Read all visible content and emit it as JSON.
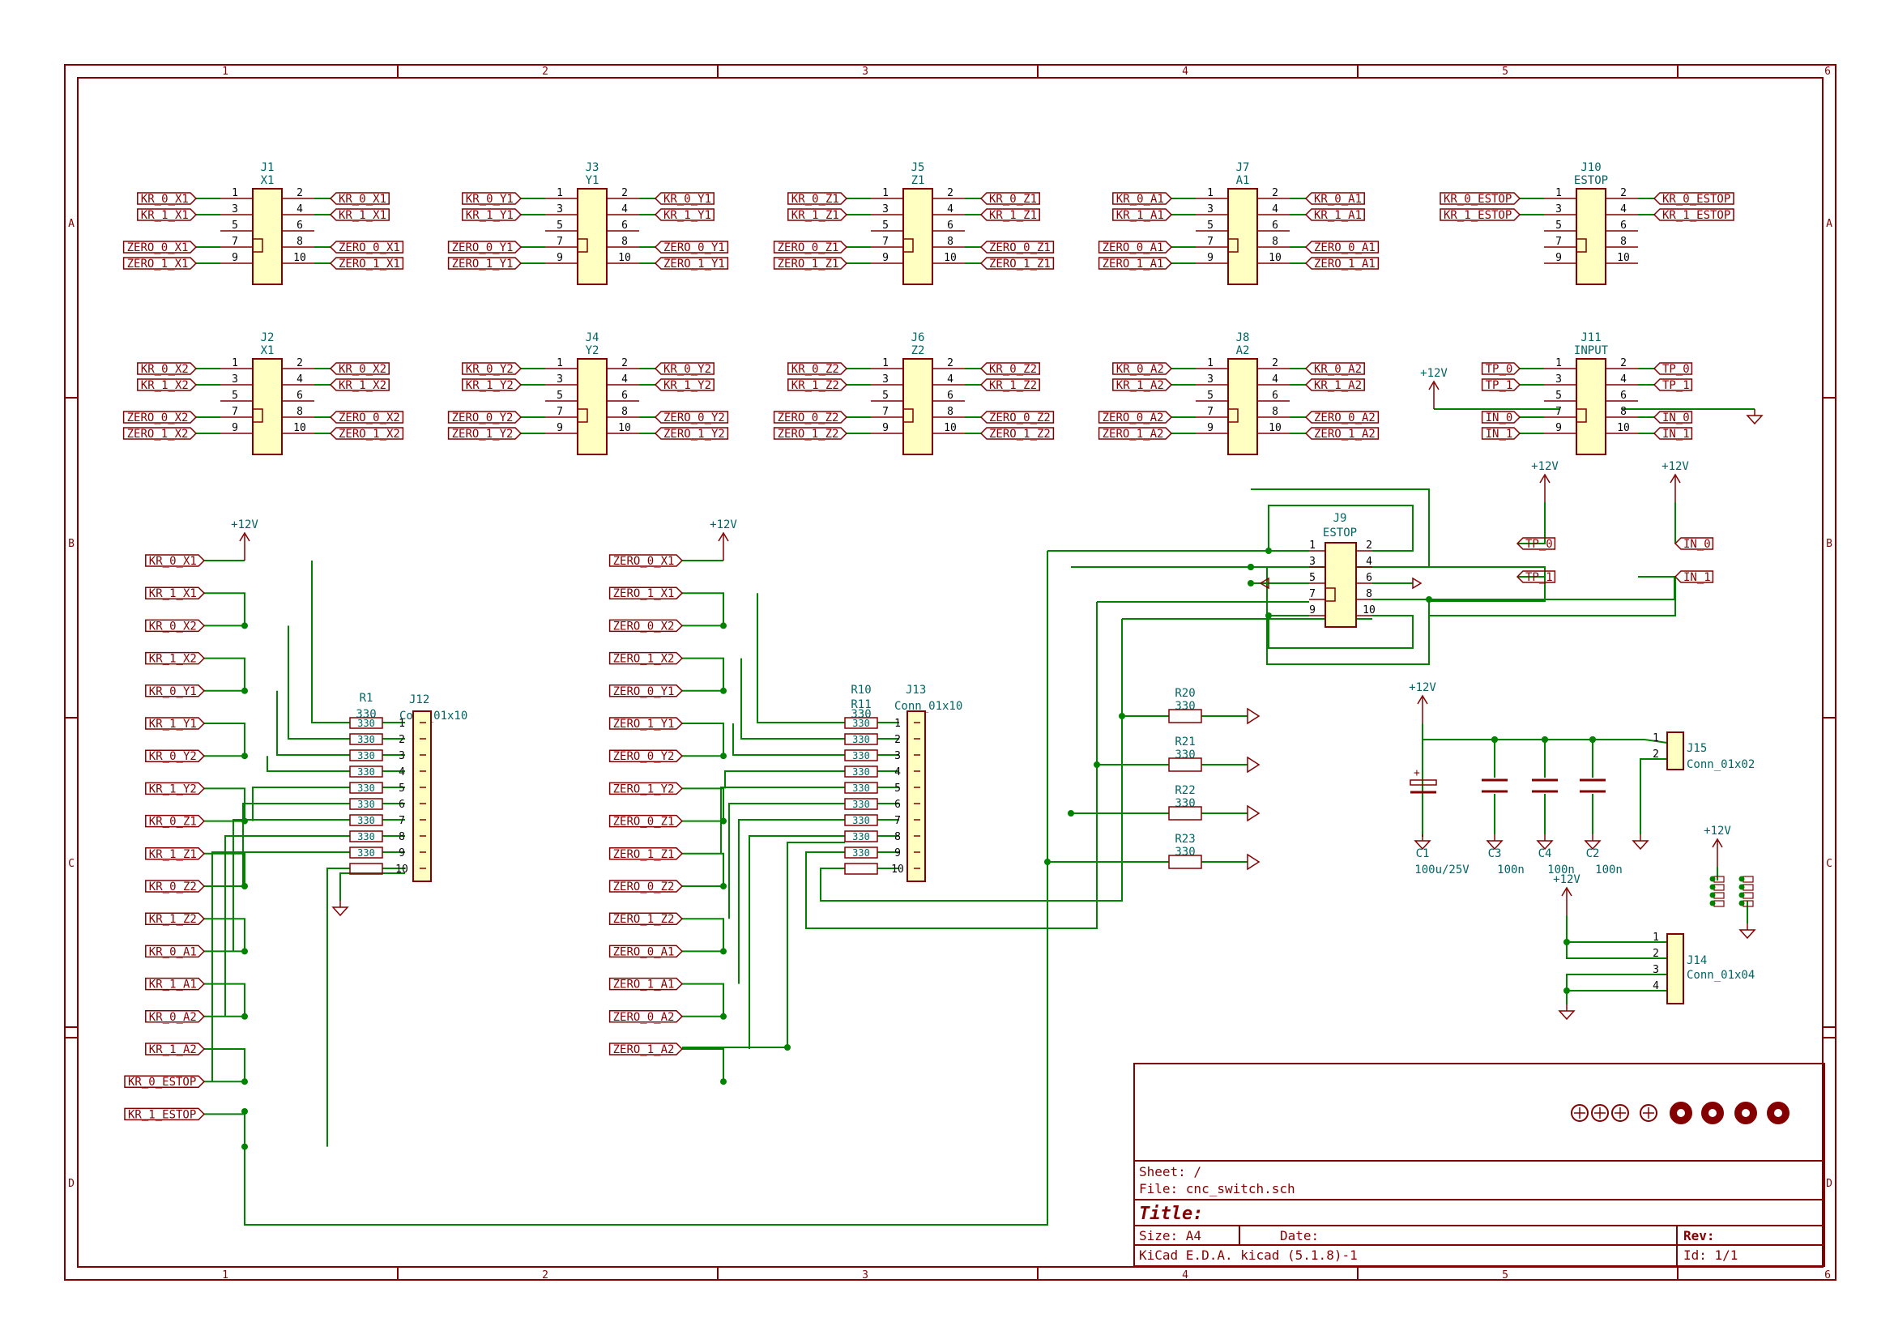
{
  "colors": {
    "frame": "#840000",
    "body_fill": "#ffffc2",
    "body_stroke": "#840000",
    "wire": "#008400",
    "ref_text": "#006464",
    "pin_num": "#000000",
    "label_text": "#840000",
    "pwr_text": "#006464",
    "pwr_symbol": "#840000",
    "junction": "#008400"
  },
  "frame": {
    "columns": [
      "1",
      "2",
      "3",
      "4",
      "5",
      "6"
    ],
    "rows": [
      "A",
      "B",
      "C",
      "D"
    ]
  },
  "title_block": {
    "sheet": "Sheet: /",
    "file": "File: cnc_switch.sch",
    "title": "Title:",
    "size": "Size: A4",
    "date": "Date:",
    "rev": "Rev:",
    "tool": "KiCad E.D.A.  kicad (5.1.8)-1",
    "id": "Id: 1/1"
  },
  "connectors": [
    {
      "ref": "J1",
      "value": "X1",
      "left": [
        "KR_0_X1",
        "KR_1_X1",
        "",
        "ZERO_0_X1",
        "ZERO_1_X1"
      ],
      "right": [
        "KR_0_X1",
        "KR_1_X1",
        "",
        "ZERO_0_X1",
        "ZERO_1_X1"
      ]
    },
    {
      "ref": "J3",
      "value": "Y1",
      "left": [
        "KR_0_Y1",
        "KR_1_Y1",
        "",
        "ZERO_0_Y1",
        "ZERO_1_Y1"
      ],
      "right": [
        "KR_0_Y1",
        "KR_1_Y1",
        "",
        "ZERO_0_Y1",
        "ZERO_1_Y1"
      ]
    },
    {
      "ref": "J5",
      "value": "Z1",
      "left": [
        "KR_0_Z1",
        "KR_1_Z1",
        "",
        "ZERO_0_Z1",
        "ZERO_1_Z1"
      ],
      "right": [
        "KR_0_Z1",
        "KR_1_Z1",
        "",
        "ZERO_0_Z1",
        "ZERO_1_Z1"
      ]
    },
    {
      "ref": "J7",
      "value": "A1",
      "left": [
        "KR_0_A1",
        "KR_1_A1",
        "",
        "ZERO_0_A1",
        "ZERO_1_A1"
      ],
      "right": [
        "KR_0_A1",
        "KR_1_A1",
        "",
        "ZERO_0_A1",
        "ZERO_1_A1"
      ]
    },
    {
      "ref": "J10",
      "value": "ESTOP",
      "left": [
        "KR_0_ESTOP",
        "KR_1_ESTOP",
        "",
        "",
        ""
      ],
      "right": [
        "KR_0_ESTOP",
        "KR_1_ESTOP",
        "",
        "",
        ""
      ]
    },
    {
      "ref": "J2",
      "value": "X1",
      "left": [
        "KR_0_X2",
        "KR_1_X2",
        "",
        "ZERO_0_X2",
        "ZERO_1_X2"
      ],
      "right": [
        "KR_0_X2",
        "KR_1_X2",
        "",
        "ZERO_0_X2",
        "ZERO_1_X2"
      ]
    },
    {
      "ref": "J4",
      "value": "Y2",
      "left": [
        "KR_0_Y2",
        "KR_1_Y2",
        "",
        "ZERO_0_Y2",
        "ZERO_1_Y2"
      ],
      "right": [
        "KR_0_Y2",
        "KR_1_Y2",
        "",
        "ZERO_0_Y2",
        "ZERO_1_Y2"
      ]
    },
    {
      "ref": "J6",
      "value": "Z2",
      "left": [
        "KR_0_Z2",
        "KR_1_Z2",
        "",
        "ZERO_0_Z2",
        "ZERO_1_Z2"
      ],
      "right": [
        "KR_0_Z2",
        "KR_1_Z2",
        "",
        "ZERO_0_Z2",
        "ZERO_1_Z2"
      ]
    },
    {
      "ref": "J8",
      "value": "A2",
      "left": [
        "KR_0_A2",
        "KR_1_A2",
        "",
        "ZERO_0_A2",
        "ZERO_1_A2"
      ],
      "right": [
        "KR_0_A2",
        "KR_1_A2",
        "",
        "ZERO_0_A2",
        "ZERO_1_A2"
      ]
    },
    {
      "ref": "J11",
      "value": "INPUT",
      "left": [
        "TP_0",
        "TP_1",
        "",
        "IN_0",
        "IN_1"
      ],
      "right": [
        "TP_0",
        "TP_1",
        "",
        "IN_0",
        "IN_1"
      ]
    }
  ],
  "pin_numbers_left": [
    "1",
    "3",
    "5",
    "7",
    "9"
  ],
  "pin_numbers_right": [
    "2",
    "4",
    "6",
    "8",
    "10"
  ],
  "kr_group": {
    "labels": [
      "KR_0_X1",
      "KR_1_X1",
      "KR_0_X2",
      "KR_1_X2",
      "KR_0_Y1",
      "KR_1_Y1",
      "KR_0_Y2",
      "KR_1_Y2",
      "KR_0_Z1",
      "KR_1_Z1",
      "KR_0_Z2",
      "KR_1_Z2",
      "KR_0_A1",
      "KR_1_A1",
      "KR_0_A2",
      "KR_1_A2",
      "KR_0_ESTOP",
      "KR_1_ESTOP"
    ],
    "resistor_ref": "R1",
    "resistor_ref_overlap": "R10",
    "resistor_value": "330",
    "resistor_values_overlap": [
      "330",
      "330",
      "330",
      "330",
      "330",
      "330",
      "330",
      "330",
      "330"
    ],
    "connector_ref": "J12",
    "connector_value": "Conn_01x10",
    "pins": [
      "1",
      "2",
      "3",
      "4",
      "5",
      "6",
      "7",
      "8",
      "9",
      "10"
    ],
    "pwr": "+12V"
  },
  "zero_group": {
    "labels": [
      "ZERO_0_X1",
      "ZERO_1_X1",
      "ZERO_0_X2",
      "ZERO_1_X2",
      "ZERO_0_Y1",
      "ZERO_1_Y1",
      "ZERO_0_Y2",
      "ZERO_1_Y2",
      "ZERO_0_Z1",
      "ZERO_1_Z1",
      "ZERO_0_Z2",
      "ZERO_1_Z2",
      "ZERO_0_A1",
      "ZERO_1_A1",
      "ZERO_0_A2",
      "ZERO_1_A2"
    ],
    "resistor_ref": "R10",
    "resistor_ref_overlap": "R11",
    "resistor_value": "330",
    "connector_ref": "J13",
    "connector_value": "Conn_01x10",
    "pins": [
      "1",
      "2",
      "3",
      "4",
      "5",
      "6",
      "7",
      "8",
      "9",
      "10"
    ],
    "pwr": "+12V"
  },
  "j9": {
    "ref": "J9",
    "value": "ESTOP",
    "left_pins": [
      "1",
      "3",
      "5",
      "7",
      "9"
    ],
    "right_pins": [
      "2",
      "4",
      "6",
      "8",
      "10"
    ]
  },
  "tp_in": {
    "labels": [
      "TP_0",
      "TP_1",
      "IN_0",
      "IN_1"
    ],
    "pwr": "+12V",
    "j11_pwr": "+12V"
  },
  "output_resistors": [
    {
      "ref": "R20",
      "value": "330"
    },
    {
      "ref": "R21",
      "value": "330"
    },
    {
      "ref": "R22",
      "value": "330"
    },
    {
      "ref": "R23",
      "value": "330"
    }
  ],
  "power_section": {
    "pwr": "+12V",
    "caps": [
      {
        "ref": "C1",
        "value": "100u/25V"
      },
      {
        "ref": "C3",
        "value": "100n"
      },
      {
        "ref": "C4",
        "value": "100n"
      },
      {
        "ref": "C2",
        "value": "100n"
      }
    ],
    "j15": {
      "ref": "J15",
      "value": "Conn_01x02",
      "pins": [
        "1",
        "2"
      ]
    },
    "j14": {
      "ref": "J14",
      "value": "Conn_01x04",
      "pins": [
        "1",
        "2",
        "3",
        "4"
      ],
      "pwr": "+12V"
    },
    "jumper_pwr": "+12V"
  }
}
